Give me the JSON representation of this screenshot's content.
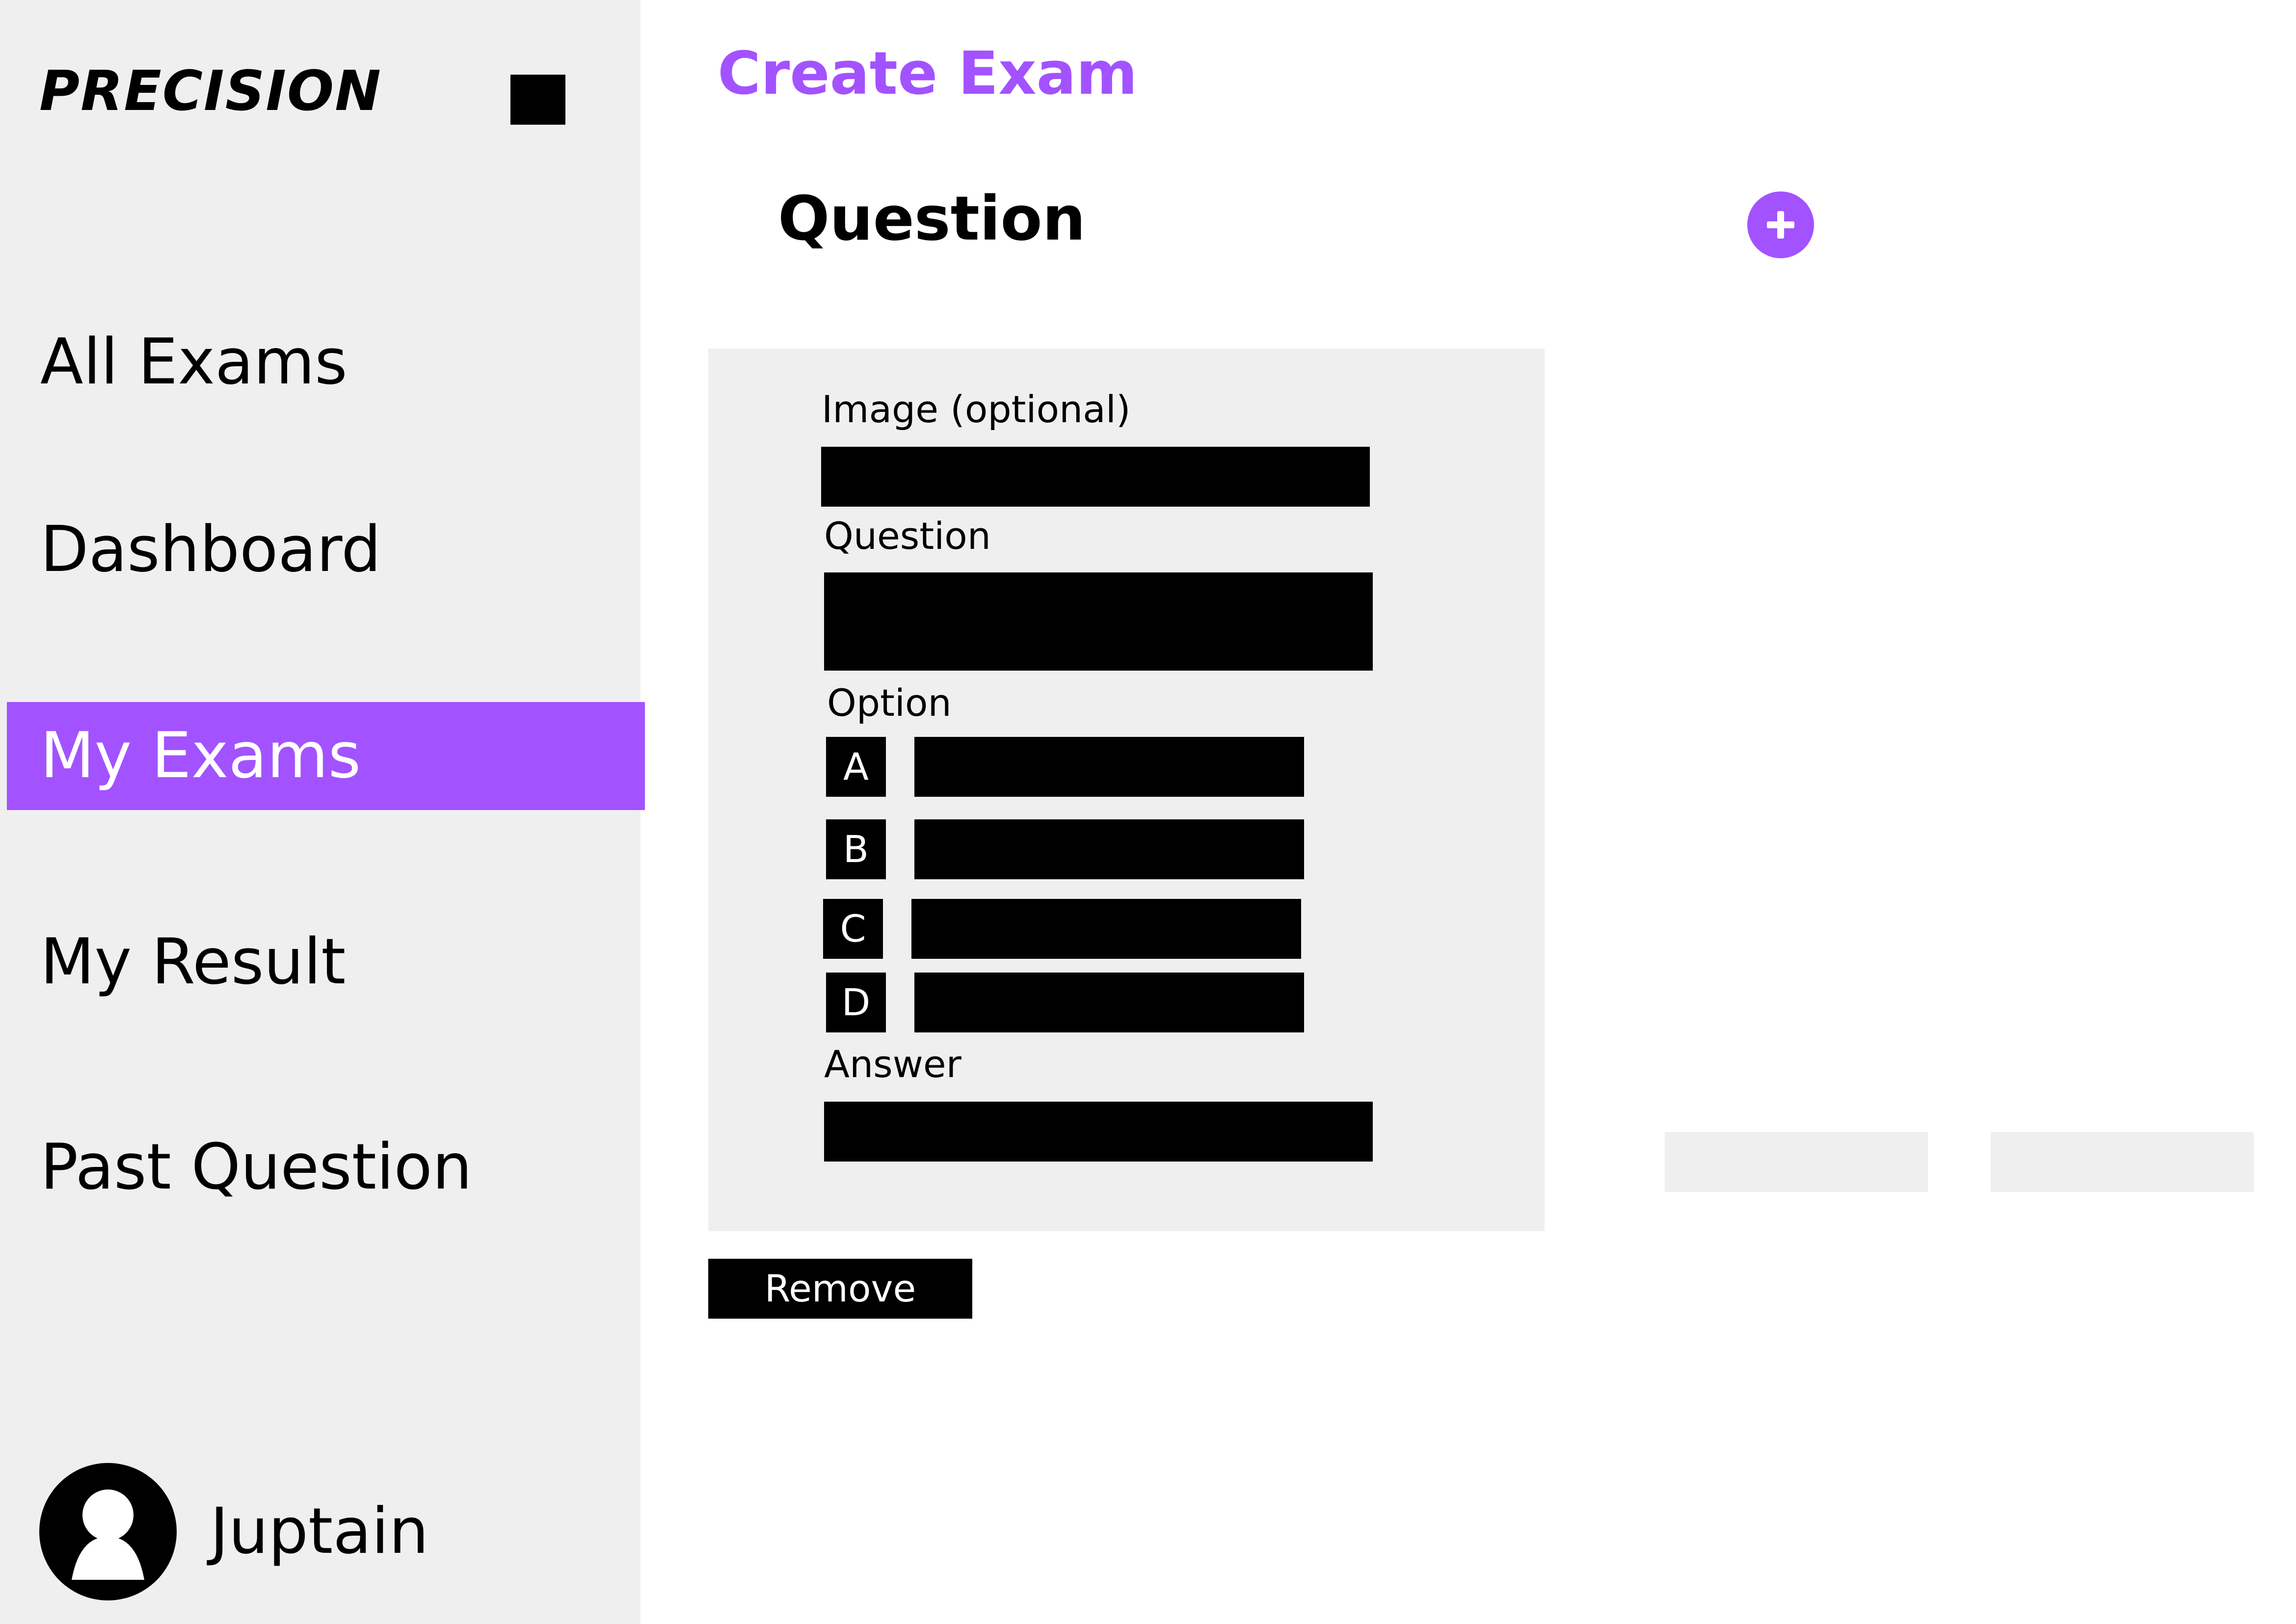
{
  "colors": {
    "accent": "#a352ff",
    "sidebar_bg": "#efefef",
    "card_bg": "#efefef",
    "field": "#000000",
    "text": "#000000"
  },
  "sidebar": {
    "logo": "PRECISION",
    "menu_icon": "square-menu-icon",
    "items": [
      {
        "label": "All Exams",
        "active": false
      },
      {
        "label": "Dashboard",
        "active": false
      },
      {
        "label": "My Exams",
        "active": true
      },
      {
        "label": "My Result",
        "active": false
      },
      {
        "label": "Past Question",
        "active": false
      }
    ],
    "user": {
      "name": "Juptain",
      "avatar_icon": "user-avatar-icon"
    }
  },
  "main": {
    "title": "Create Exam",
    "section_title": "Question",
    "add_icon": "plus-circle-icon",
    "card": {
      "image_label": "Image (optional)",
      "question_label": "Question",
      "option_label": "Option",
      "options": [
        "A",
        "B",
        "C",
        "D"
      ],
      "answer_label": "Answer"
    },
    "remove_label": "Remove"
  }
}
